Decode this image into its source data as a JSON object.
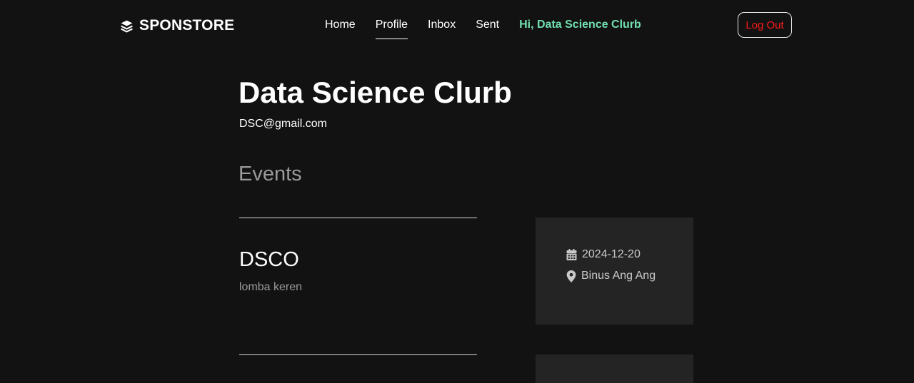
{
  "brand": {
    "name": "SPONSTORE",
    "icon": "layers-icon"
  },
  "nav": {
    "links": [
      {
        "label": "Home",
        "active": false
      },
      {
        "label": "Profile",
        "active": true
      },
      {
        "label": "Inbox",
        "active": false
      },
      {
        "label": "Sent",
        "active": false
      }
    ],
    "greeting": "Hi, Data Science Clurb",
    "greeting_color": "#72e0b0",
    "logout_label": "Log Out",
    "logout_color": "#ff1a1a"
  },
  "profile": {
    "name": "Data Science Clurb",
    "email": "DSC@gmail.com"
  },
  "events": {
    "section_title": "Events",
    "items": [
      {
        "title": "DSCO",
        "description": "lomba keren",
        "date": "2024-12-20",
        "date_icon": "calendar-icon",
        "location": "Binus Ang Ang",
        "location_icon": "map-pin-icon"
      }
    ]
  }
}
